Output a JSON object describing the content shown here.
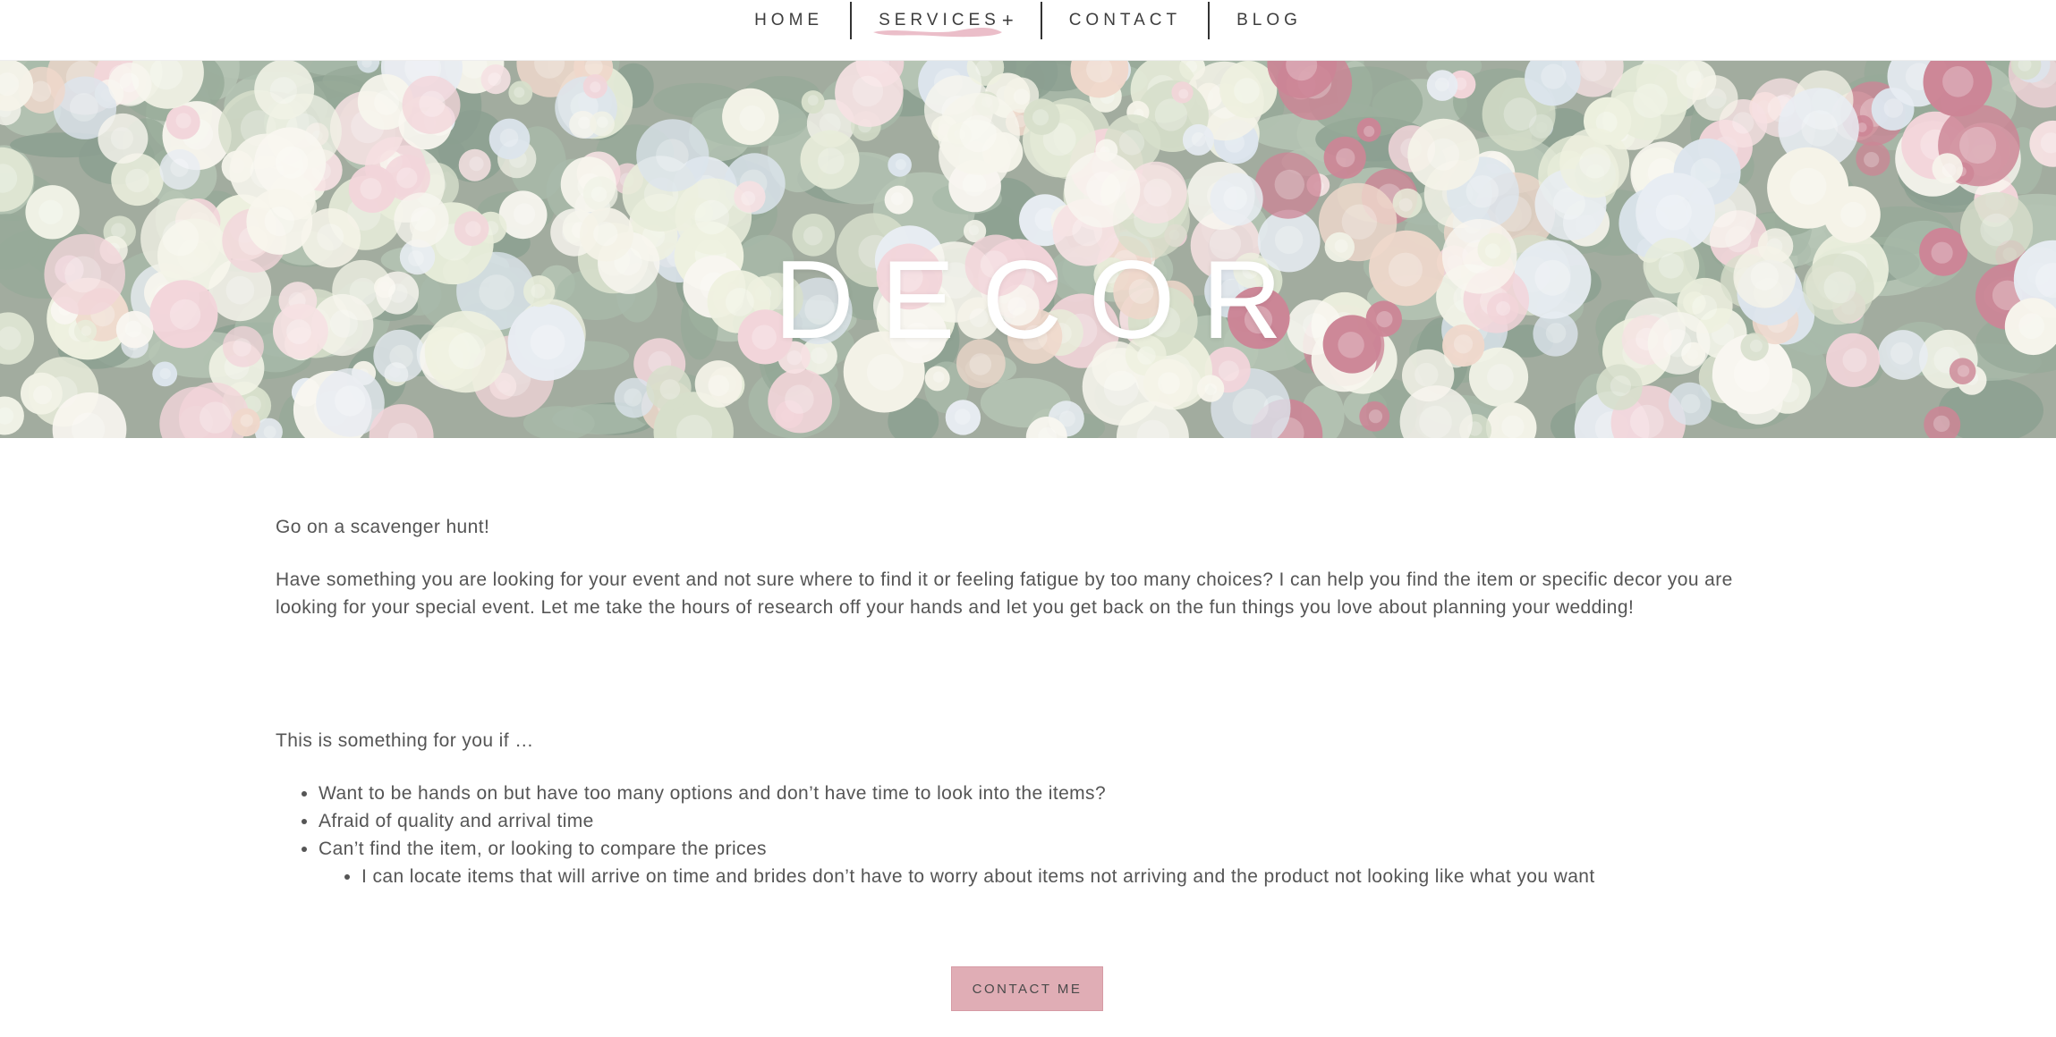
{
  "nav": {
    "items": [
      {
        "label": "HOME"
      },
      {
        "label": "SERVICES",
        "has_submenu": true,
        "submenu_icon": "+",
        "active": true
      },
      {
        "label": "CONTACT"
      },
      {
        "label": "BLOG"
      }
    ],
    "active_underline_color": "#e7b3c0"
  },
  "hero": {
    "title": "DECOR",
    "background": "flower-arrangement-image"
  },
  "content": {
    "intro": "Go on a scavenger hunt!",
    "description": "Have something you are looking for your event and not sure where to find it or feeling fatigue by too many choices? I can help you find the item or specific decor you are looking for your special event.  Let me take the hours of research off your hands and let you get back on the fun things you love about planning your wedding!",
    "for_you_heading": "This is something for you if …",
    "bullets": [
      "Want to be hands on but have too many options and don’t have time to look into the items?",
      "Afraid of quality and arrival time",
      "Can’t find the item, or looking to compare the prices"
    ],
    "sub_bullets": [
      "I can locate items that will arrive on time and brides don’t have to worry about items not arriving and the product not looking like what you want"
    ]
  },
  "cta": {
    "label": "CONTACT ME",
    "color": "#e0adb5"
  }
}
